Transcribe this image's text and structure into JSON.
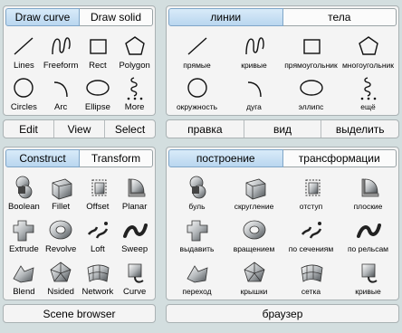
{
  "left": {
    "draw_tabs": [
      "Draw curve",
      "Draw solid"
    ],
    "draw_tools": [
      "Lines",
      "Freeform",
      "Rect",
      "Polygon",
      "Circles",
      "Arc",
      "Ellipse",
      "More"
    ],
    "menu": [
      "Edit",
      "View",
      "Select"
    ],
    "build_tabs": [
      "Construct",
      "Transform"
    ],
    "build_tools": [
      "Boolean",
      "Fillet",
      "Offset",
      "Planar",
      "Extrude",
      "Revolve",
      "Loft",
      "Sweep",
      "Blend",
      "Nsided",
      "Network",
      "Curve"
    ],
    "browser": "Scene browser"
  },
  "right": {
    "draw_tabs": [
      "линии",
      "тела"
    ],
    "draw_tools": [
      "прямые",
      "кривые",
      "прямоугольник",
      "многоугольник",
      "окружность",
      "дуга",
      "эллипс",
      "ещё"
    ],
    "menu": [
      "правка",
      "вид",
      "выделить"
    ],
    "build_tabs": [
      "построение",
      "трансформации"
    ],
    "build_tools": [
      "буль",
      "скругление",
      "отступ",
      "плоские",
      "выдавить",
      "вращением",
      "по сечениям",
      "по рельсам",
      "переход",
      "крышки",
      "сетка",
      "кривые"
    ],
    "browser": "браузер"
  },
  "icons": {
    "draw": [
      "line-icon",
      "freeform-icon",
      "rect-icon",
      "polygon-icon",
      "circle-icon",
      "arc-icon",
      "ellipse-icon",
      "more-icon"
    ],
    "build": [
      "boolean-icon",
      "fillet-icon",
      "offset-icon",
      "planar-icon",
      "extrude-icon",
      "revolve-icon",
      "loft-icon",
      "sweep-icon",
      "blend-icon",
      "nsided-icon",
      "network-icon",
      "curve-icon"
    ]
  },
  "colors": {
    "background": "#d3dedf",
    "panel": "#f4f4f4",
    "active_tab": "#c4ddf2"
  }
}
